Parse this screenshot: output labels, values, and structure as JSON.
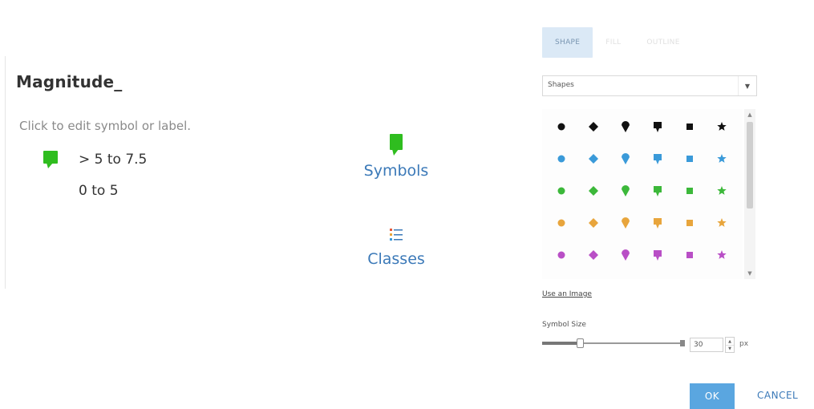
{
  "layer": {
    "title": "Magnitude_",
    "hint": "Click to edit symbol or label.",
    "legend": [
      {
        "label": "> 5 to 7.5",
        "symbol": "green-pin-icon",
        "color": "#2fbd1f"
      },
      {
        "label": "0 to 5",
        "symbol": "none"
      }
    ]
  },
  "nav": {
    "symbols_label": "Symbols",
    "classes_label": "Classes"
  },
  "symbol_panel": {
    "tabs": [
      {
        "label": "SHAPE",
        "active": true
      },
      {
        "label": "FILL",
        "active": false
      },
      {
        "label": "OUTLINE",
        "active": false
      }
    ],
    "category_select": {
      "value": "Shapes"
    },
    "shape_rows": [
      {
        "color": "#111111",
        "shapes": [
          "circle",
          "diamond",
          "pin-round",
          "pin-square",
          "square",
          "star"
        ]
      },
      {
        "color": "#3a9ad9",
        "shapes": [
          "circle",
          "diamond",
          "pin-round",
          "pin-square",
          "square",
          "star"
        ]
      },
      {
        "color": "#3cb83a",
        "shapes": [
          "circle",
          "diamond",
          "pin-round",
          "pin-square",
          "square",
          "star"
        ]
      },
      {
        "color": "#e8a53c",
        "shapes": [
          "circle",
          "diamond",
          "pin-round",
          "pin-square",
          "square",
          "star"
        ]
      },
      {
        "color": "#b94fc6",
        "shapes": [
          "circle",
          "diamond",
          "pin-round",
          "pin-square",
          "square",
          "star"
        ]
      }
    ],
    "use_image_link": "Use an Image",
    "symbol_size_label": "Symbol Size",
    "symbol_size_value": "30",
    "slider_fraction": 0.25,
    "unit": "px"
  },
  "footer": {
    "ok_label": "OK",
    "cancel_label": "CANCEL"
  },
  "colors": {
    "accent": "#5aa6e0",
    "link": "#3b79b8",
    "pin_green": "#2fbd1f"
  }
}
